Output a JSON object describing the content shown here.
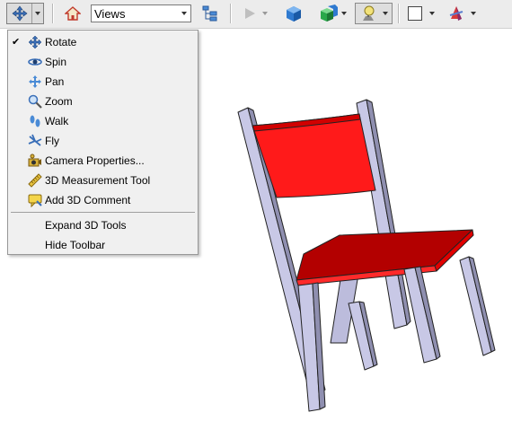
{
  "toolbar": {
    "views_value": "Views",
    "tools": [
      "rotate-tool-icon",
      "home-view-icon",
      "model-tree-icon",
      "play-animation-icon",
      "solid-render-icon",
      "lighting-icon",
      "background-color-icon",
      "cross-section-icon"
    ]
  },
  "menu": {
    "items": [
      {
        "label": "Rotate",
        "checked": true,
        "icon": "rotate-icon"
      },
      {
        "label": "Spin",
        "checked": false,
        "icon": "spin-icon"
      },
      {
        "label": "Pan",
        "checked": false,
        "icon": "pan-icon"
      },
      {
        "label": "Zoom",
        "checked": false,
        "icon": "zoom-icon"
      },
      {
        "label": "Walk",
        "checked": false,
        "icon": "walk-icon"
      },
      {
        "label": "Fly",
        "checked": false,
        "icon": "fly-icon"
      },
      {
        "label": "Camera Properties...",
        "checked": false,
        "icon": "camera-icon"
      },
      {
        "label": "3D Measurement Tool",
        "checked": false,
        "icon": "ruler-icon"
      },
      {
        "label": "Add 3D Comment",
        "checked": false,
        "icon": "comment-icon"
      }
    ],
    "extra": [
      {
        "label": "Expand 3D Tools"
      },
      {
        "label": "Hide Toolbar"
      }
    ],
    "check_glyph": "✔"
  },
  "colors": {
    "chair_red": "#ff1010",
    "chair_dark_red": "#b00000",
    "chair_frame": "#c8c8e6"
  }
}
